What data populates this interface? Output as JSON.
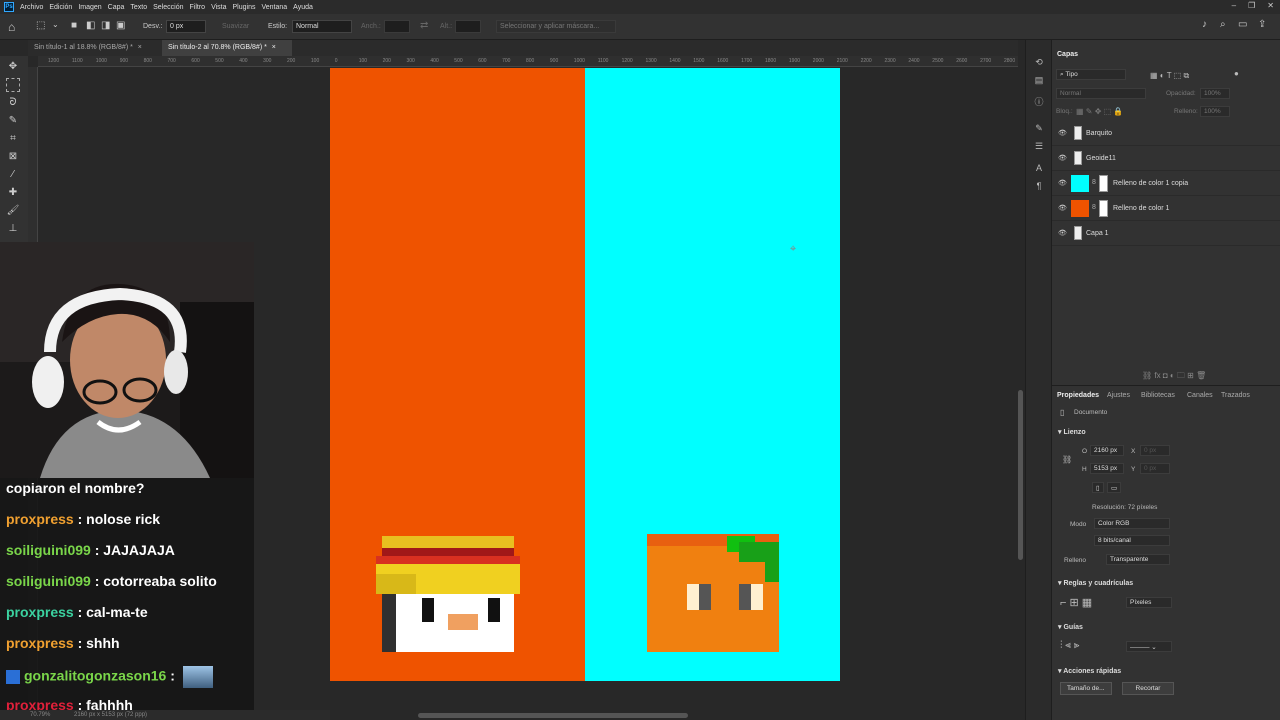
{
  "menubar": {
    "logo": "Ps",
    "items": [
      "Archivo",
      "Edición",
      "Imagen",
      "Capa",
      "Texto",
      "Selección",
      "Filtro",
      "Vista",
      "Plugins",
      "Ventana",
      "Ayuda"
    ]
  },
  "options": {
    "feather_label": "Desv.:",
    "feather_value": "0 px",
    "smooth_label": "Suavizar",
    "style_label": "Estilo:",
    "style_value": "Normal",
    "width_label": "Anch.:",
    "height_label": "Alt.:",
    "mask_button": "Seleccionar y aplicar máscara..."
  },
  "tabs": [
    {
      "label": "Sin título-1 al 18.8% (RGB/8#) *"
    },
    {
      "label": "Sin título-2 al 70.8% (RGB/8#) *"
    }
  ],
  "ruler_ticks": [
    "1200",
    "1100",
    "1000",
    "900",
    "800",
    "700",
    "600",
    "500",
    "400",
    "300",
    "200",
    "100",
    "0",
    "100",
    "200",
    "300",
    "400",
    "500",
    "600",
    "700",
    "800",
    "900",
    "1000",
    "1100",
    "1200",
    "1300",
    "1400",
    "1500",
    "1600",
    "1700",
    "1800",
    "1900",
    "2000",
    "2100",
    "2200",
    "2300",
    "2400",
    "2500",
    "2600",
    "2700",
    "2800"
  ],
  "status": {
    "zoom": "70.79%",
    "doc_size": "2160 px x 5153 px (72 ppp)"
  },
  "layers_panel": {
    "tab": "Capas",
    "filter": "Tipo",
    "blend_mode": "Normal",
    "opacity_label": "Opacidad:",
    "opacity_value": "100%",
    "lock_label": "Bloq.:",
    "fill_label": "Relleno:",
    "fill_value": "100%",
    "layers": [
      {
        "name": "Barquito",
        "thumb": "doc"
      },
      {
        "name": "Geoide11",
        "thumb": "doc"
      },
      {
        "name": "Relleno de color 1 copia",
        "thumb": "#00ffff"
      },
      {
        "name": "Relleno de color 1",
        "thumb": "#ef5300"
      },
      {
        "name": "Capa 1",
        "thumb": "doc"
      }
    ]
  },
  "properties_panel": {
    "tabs": [
      "Propiedades",
      "Ajustes",
      "Bibliotecas",
      "Canales",
      "Trazados"
    ],
    "doc_label": "Documento",
    "canvas_section": "Lienzo",
    "width_label": "O",
    "width_value": "2160 px",
    "x_label": "X",
    "x_value": "0 px",
    "height_label": "H",
    "height_value": "5153 px",
    "y_label": "Y",
    "y_value": "0 px",
    "resolution": "Resolución: 72 píxeles",
    "mode_label": "Modo",
    "mode_value": "Color RGB",
    "bits_value": "8 bits/canal",
    "fill_label": "Relleno",
    "fill_value": "Transparente",
    "rulers_section": "Reglas y cuadrículas",
    "units_value": "Píxeles",
    "guides_section": "Guías",
    "quick_actions_section": "Acciones rápidas",
    "image_size_button": "Tamaño de...",
    "crop_button": "Recortar"
  },
  "chat": [
    {
      "user": "",
      "user_color": "#ffffff",
      "message": "copiaron el nombre?"
    },
    {
      "user": "proxpress",
      "user_color": "#f0a030",
      "message": " : nolose rick"
    },
    {
      "user": "soiliguini099",
      "user_color": "#7ad64a",
      "message": " : JAJAJAJA"
    },
    {
      "user": "soiliguini099",
      "user_color": "#7ad64a",
      "message": " : cotorreaba solito"
    },
    {
      "user": "proxpress",
      "user_color": "#3bd2a0",
      "message": " : cal-ma-te"
    },
    {
      "user": "proxpress",
      "user_color": "#f0a030",
      "message": " : shhh"
    },
    {
      "user": "gonzalitogonzason16",
      "user_color": "#7ad64a",
      "message": " :"
    },
    {
      "user": "proxpress",
      "user_color": "#e0203a",
      "message": " : fahhhh"
    }
  ],
  "colors": {
    "canvas_left": "#ef5300",
    "canvas_right": "#00ffff",
    "ui_bg": "#323232"
  }
}
